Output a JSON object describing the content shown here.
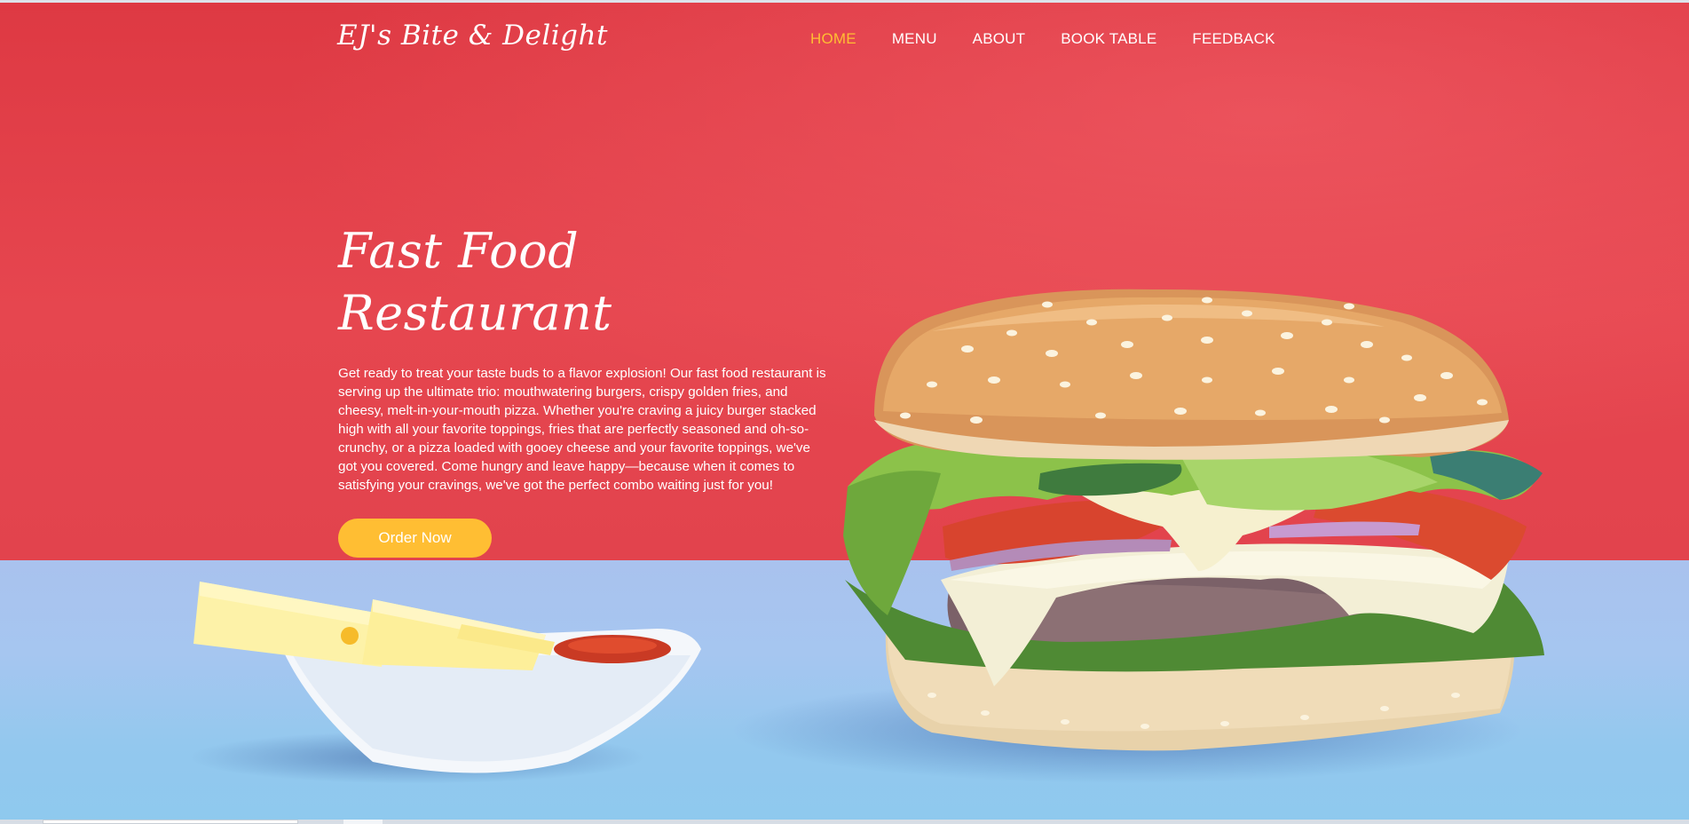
{
  "header": {
    "brand": "EJ's Bite & Delight",
    "nav": [
      {
        "label": "HOME",
        "active": true
      },
      {
        "label": "MENU",
        "active": false
      },
      {
        "label": "ABOUT",
        "active": false
      },
      {
        "label": "BOOK TABLE",
        "active": false
      },
      {
        "label": "FEEDBACK",
        "active": false
      }
    ]
  },
  "hero": {
    "title": "Fast Food Restaurant",
    "description": "Get ready to treat your taste buds to a flavor explosion! Our fast food restaurant is serving up the ultimate trio: mouthwatering burgers, crispy golden fries, and cheesy, melt-in-your-mouth pizza. Whether you're craving a juicy burger stacked high with all your favorite toppings, fries that are perfectly seasoned and oh-so-crunchy, or a pizza loaded with gooey cheese and your favorite toppings, we've got you covered. Come hungry and leave happy—because when it comes to satisfying your cravings, we've got the perfect combo waiting just for you!",
    "cta_label": "Order Now",
    "carousel_dots": 1
  },
  "colors": {
    "accent": "#ffbe33",
    "wall": "#e4434d",
    "table": "#a6c6f0",
    "text": "#ffffff"
  },
  "images": {
    "burger": "burger-image",
    "fries": "fries-with-ketchup-image"
  }
}
